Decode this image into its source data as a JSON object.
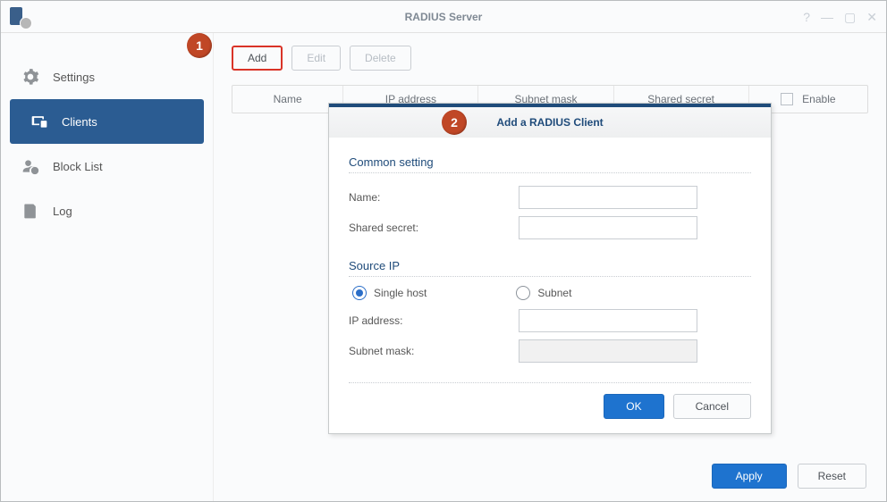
{
  "window": {
    "title": "RADIUS Server"
  },
  "sidebar": {
    "items": [
      {
        "label": "Settings"
      },
      {
        "label": "Clients"
      },
      {
        "label": "Block List"
      },
      {
        "label": "Log"
      }
    ],
    "active_index": 1
  },
  "toolbar": {
    "add": "Add",
    "edit": "Edit",
    "delete": "Delete"
  },
  "table": {
    "columns": [
      "Name",
      "IP address",
      "Subnet mask",
      "Shared secret",
      "Enable"
    ]
  },
  "modal": {
    "title": "Add a RADIUS Client",
    "section_common": "Common setting",
    "label_name": "Name:",
    "label_secret": "Shared secret:",
    "value_name": "",
    "value_secret": "",
    "section_source": "Source IP",
    "radio_single": "Single host",
    "radio_subnet": "Subnet",
    "label_ip": "IP address:",
    "label_mask": "Subnet mask:",
    "value_ip": "",
    "value_mask": "",
    "ok": "OK",
    "cancel": "Cancel"
  },
  "footer": {
    "apply": "Apply",
    "reset": "Reset"
  },
  "callouts": {
    "one": "1",
    "two": "2"
  }
}
